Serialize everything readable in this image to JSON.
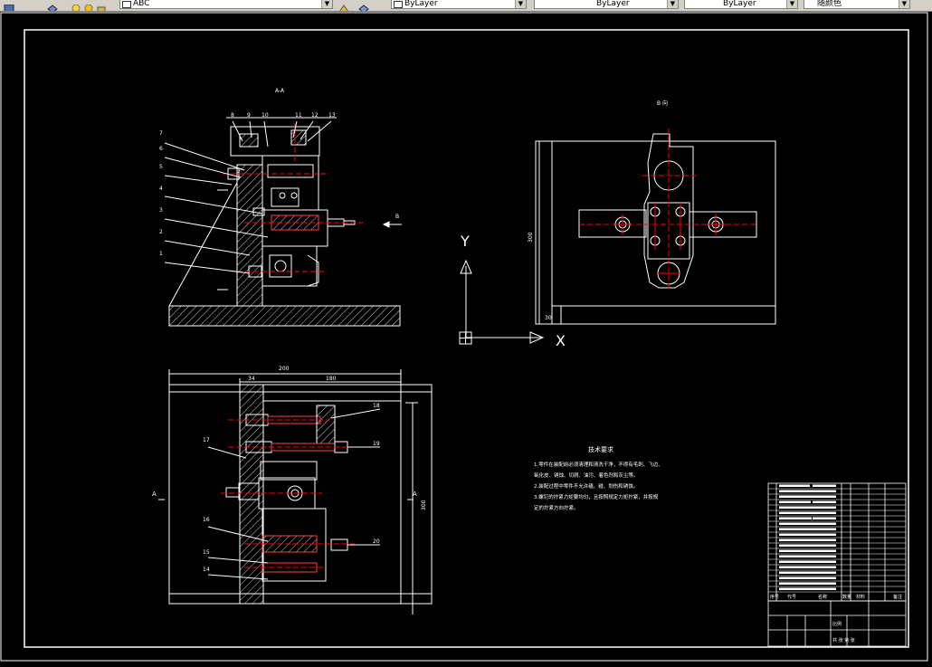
{
  "toolbar": {
    "layer_value": "ABC",
    "color_value": "ByLayer",
    "linetype_value": "ByLayer",
    "lineweight_value": "ByLayer",
    "plotstyle_value": "随颜色"
  },
  "drawing": {
    "section_label": "A-A",
    "view_b_label": "B 向",
    "arrow_b_label": "B",
    "part_numbers_top": [
      "8",
      "9",
      "10",
      "11",
      "12",
      "13"
    ],
    "part_numbers_left": [
      "7",
      "6",
      "5",
      "4",
      "3",
      "2",
      "1"
    ],
    "part_numbers_bottom_right": [
      "18",
      "19",
      "20"
    ],
    "part_numbers_bottom_left": [
      "17",
      "16",
      "15",
      "14"
    ],
    "dim_overall_width": "200",
    "dim_left": "34",
    "dim_right": "180",
    "dim_height": "300",
    "dim_base": "30",
    "section_mark_left": "A",
    "section_mark_right": "A",
    "ucs_y": "Y",
    "ucs_x": "X"
  },
  "notes": {
    "title": "技术要求",
    "lines": [
      "1.零件在装配前必须清理和清洗干净，不得有毛刺、飞边、",
      "氧化皮、锈蚀、切屑、油污、着色剂和灰尘等。",
      "2.装配过程中零件不允许磕、碰、划伤和锈蚀。",
      "3.螺钉的拧紧力矩要均匀，且按照规定力矩拧紧，并按规",
      "定的拧紧方向拧紧。"
    ]
  },
  "title_block": {
    "header": [
      "序号",
      "代号",
      "名称",
      "数量",
      "材料",
      "备注"
    ],
    "scale_label": "比例",
    "sheet_label": "共 张 第 张"
  },
  "colors": {
    "background": "#000000",
    "line_white": "#ffffff",
    "center_red": "#ff0000",
    "toolbar_gray": "#d4d0c8"
  }
}
